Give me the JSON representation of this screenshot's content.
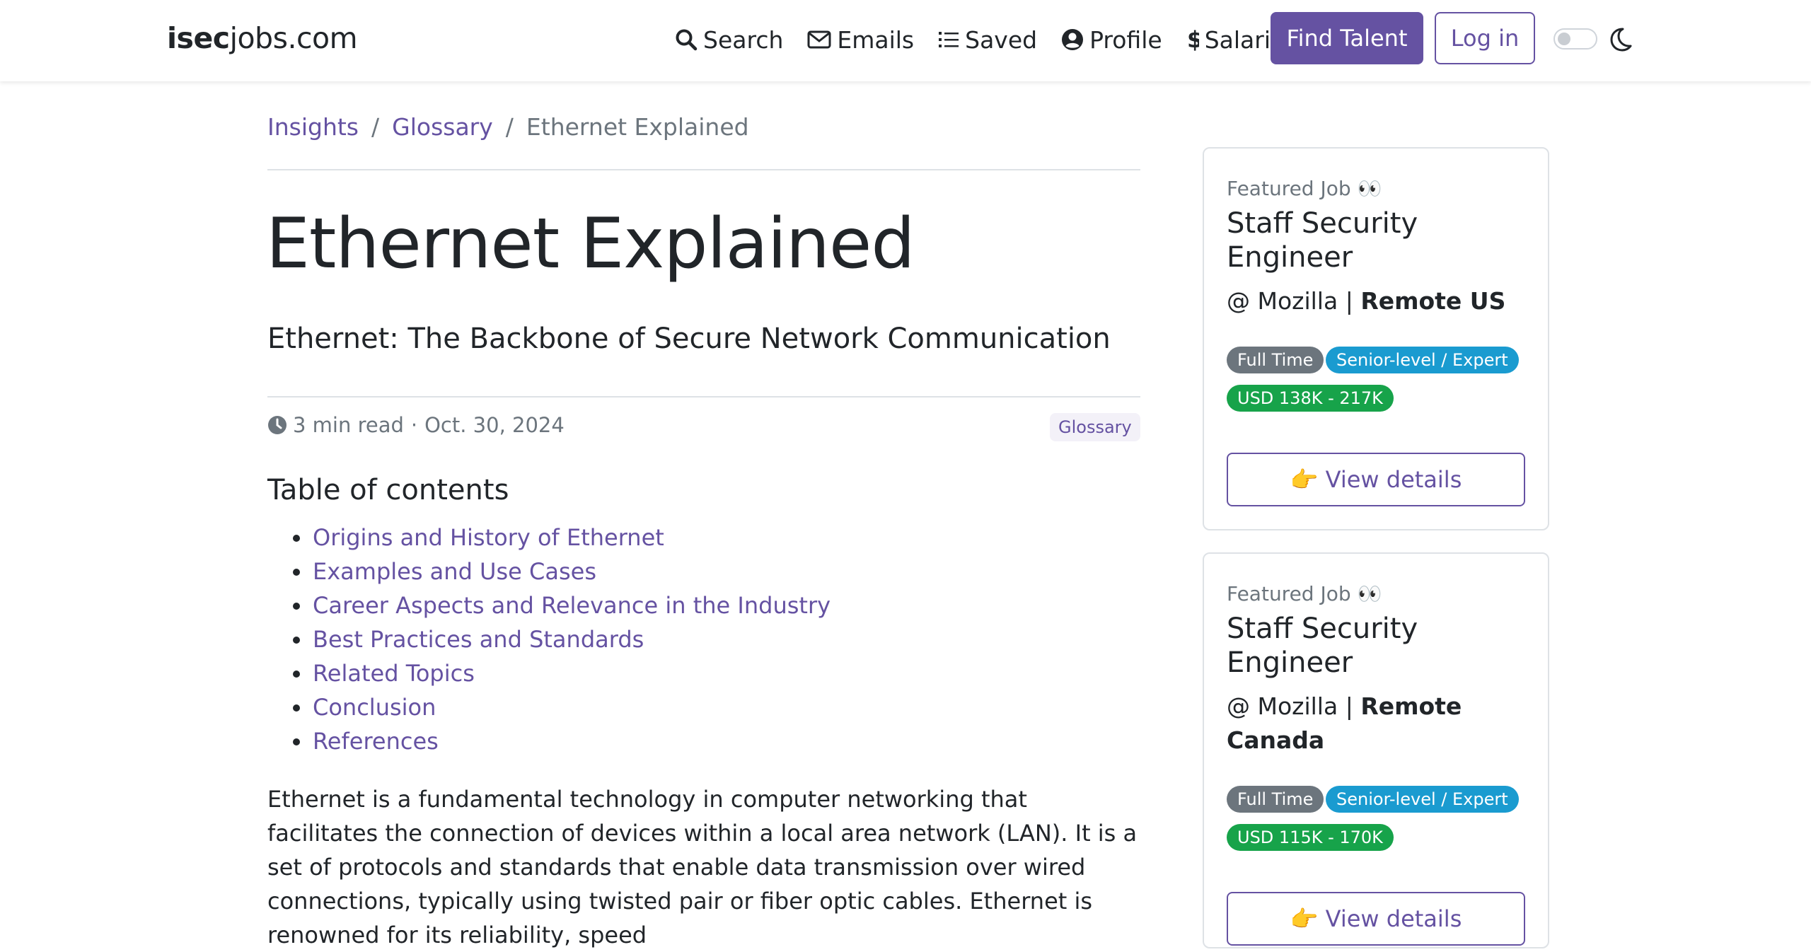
{
  "nav": {
    "brand_bold": "isec",
    "brand_rest": "jobs.com",
    "links": [
      "Search",
      "Emails",
      "Saved",
      "Profile",
      "Salaries"
    ],
    "find_talent": "Find Talent",
    "login": "Log in"
  },
  "breadcrumb": [
    "Insights",
    "Glossary",
    "Ethernet Explained"
  ],
  "article": {
    "title": "Ethernet Explained",
    "subtitle": "Ethernet: The Backbone of Secure Network Communication",
    "read_time": "3 min read",
    "date": "Oct. 30, 2024",
    "category": "Glossary",
    "toc_title": "Table of contents",
    "toc": [
      "Origins and History of Ethernet",
      "Examples and Use Cases",
      "Career Aspects and Relevance in the Industry",
      "Best Practices and Standards",
      "Related Topics",
      "Conclusion",
      "References"
    ],
    "intro": "Ethernet is a fundamental technology in computer networking that facilitates the connection of devices within a local area network (LAN). It is a set of protocols and standards that enable data transmission over wired connections, typically using twisted pair or fiber optic cables. Ethernet is renowned for its reliability, speed"
  },
  "jobs": [
    {
      "featured": "Featured Job 👀",
      "title": "Staff Security Engineer",
      "company": "@ Mozilla |",
      "location": "Remote US",
      "type": "Full Time",
      "level": "Senior-level / Expert",
      "salary": "USD 138K - 217K",
      "cta": "👉 View details"
    },
    {
      "featured": "Featured Job 👀",
      "title": "Staff Security Engineer",
      "company": "@ Mozilla |",
      "location": "Remote Canada",
      "type": "Full Time",
      "level": "Senior-level / Expert",
      "salary": "USD 115K - 170K",
      "cta": "👉 View details"
    }
  ]
}
